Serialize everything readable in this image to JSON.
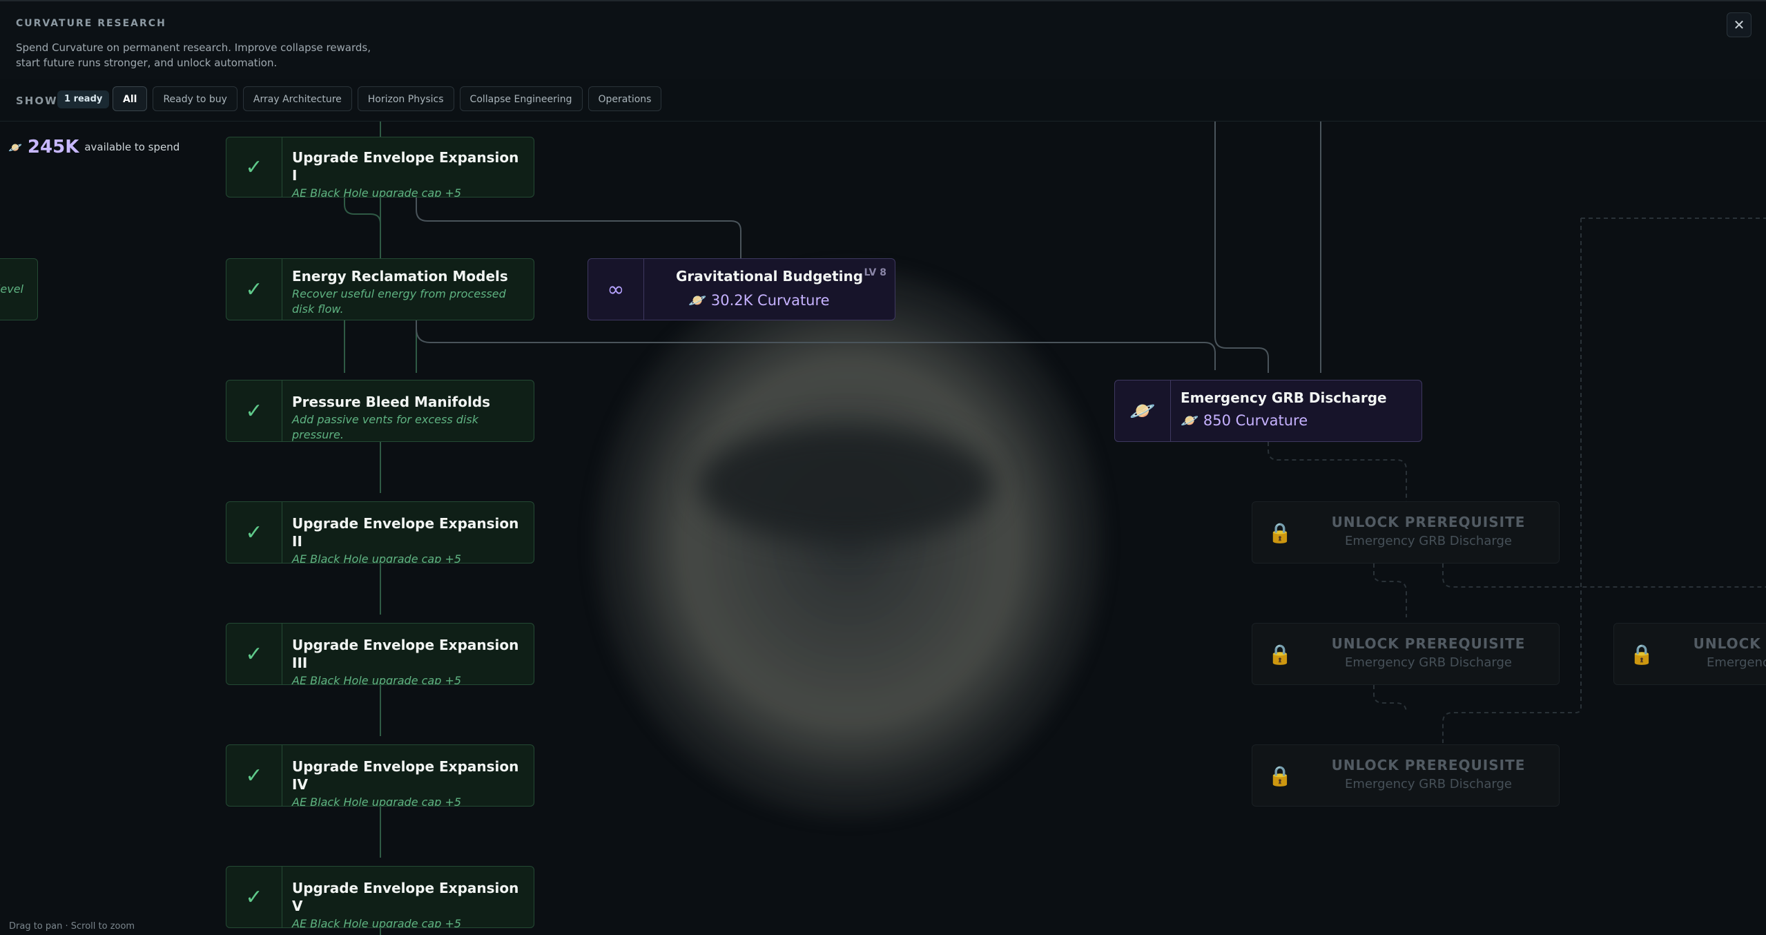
{
  "header": {
    "title": "CURVATURE RESEARCH",
    "subtitle": "Spend Curvature on permanent research. Improve collapse rewards, start future runs stronger, and unlock automation.",
    "close": "✕"
  },
  "filterbar": {
    "show_label": "SHOW",
    "ready_badge": "1 ready",
    "filters": [
      "All",
      "Ready to buy",
      "Array Architecture",
      "Horizon Physics",
      "Collapse Engineering",
      "Operations"
    ]
  },
  "budget": {
    "amount": "245K",
    "label": "available to spend"
  },
  "side_stub": "level",
  "completed": [
    {
      "name": "Upgrade Envelope Expansion I",
      "desc": "AE Black Hole upgrade cap +5"
    },
    {
      "name": "Energy Reclamation Models",
      "desc": "Recover useful energy from processed disk flow."
    },
    {
      "name": "Pressure Bleed Manifolds",
      "desc": "Add passive vents for excess disk pressure."
    },
    {
      "name": "Upgrade Envelope Expansion II",
      "desc": "AE Black Hole upgrade cap +5"
    },
    {
      "name": "Upgrade Envelope Expansion III",
      "desc": "AE Black Hole upgrade cap +5"
    },
    {
      "name": "Upgrade Envelope Expansion IV",
      "desc": "AE Black Hole upgrade cap +5"
    },
    {
      "name": "Upgrade Envelope Expansion V",
      "desc": "AE Black Hole upgrade cap +5"
    }
  ],
  "gravitational": {
    "name": "Gravitational Budgeting",
    "level": "LV 8",
    "cost": "30.2K Curvature",
    "icon": "∞"
  },
  "emergency": {
    "name": "Emergency GRB Discharge",
    "cost": "850 Curvature"
  },
  "locked": [
    {
      "title": "UNLOCK PREREQUISITE",
      "req": "Emergency GRB Discharge"
    },
    {
      "title": "UNLOCK PREREQUISITE",
      "req": "Emergency GRB Discharge"
    },
    {
      "title": "UNLOCK PREREQUISITE",
      "req": "Emergency GRB Discharge"
    },
    {
      "title": "UNLOCK PREREQUISITE",
      "req": "Emergency GRB Discharge"
    }
  ],
  "hint": "Drag to pan · Scroll to zoom"
}
